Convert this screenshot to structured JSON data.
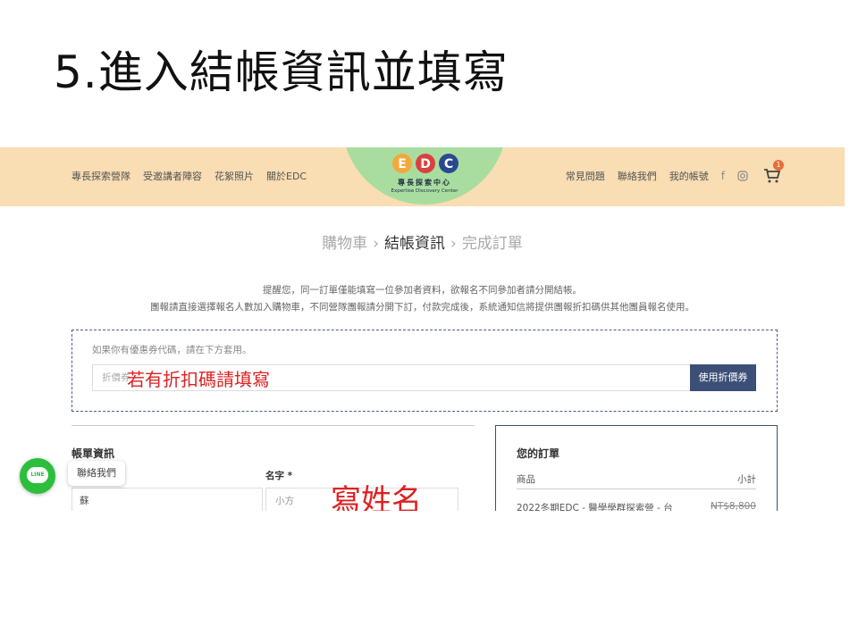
{
  "slide": {
    "title": "5.進入結帳資訊並填寫"
  },
  "header": {
    "nav_left": [
      "專長探索營隊",
      "受邀講者陣容",
      "花絮照片",
      "關於EDC"
    ],
    "nav_right": [
      "常見問題",
      "聯絡我們",
      "我的帳號"
    ],
    "cart_count": "1",
    "logo": {
      "letters": [
        "E",
        "D",
        "C"
      ],
      "cn": "專長探索中心",
      "en": "Expertise Discovery Center"
    },
    "colors": {
      "bar": "#f9ddb3",
      "logo_bg": "#a9dda0"
    }
  },
  "steps": {
    "items": [
      "購物車",
      "結帳資訊",
      "完成訂單"
    ],
    "current_index": 1
  },
  "notice": {
    "line1": "提醒您，同一訂單僅能填寫一位參加者資料，欲報名不同參加者請分開結帳。",
    "line2": "團報請直接選擇報名人數加入購物車，不同營隊團報請分開下訂，付款完成後，系統通知信將提供團報折扣碼供其他團員報名使用。"
  },
  "coupon": {
    "hint": "如果你有優惠券代碼，請在下方套用。",
    "placeholder": "折價券",
    "button": "使用折價券",
    "annotation": "若有折扣碼請填寫"
  },
  "billing": {
    "title": "帳單資訊",
    "first_name_label": "名字 *",
    "last_name_value": "蘇",
    "first_name_value": "小方",
    "annotation": "寫姓名"
  },
  "order": {
    "title": "您的訂單",
    "col_product": "商品",
    "col_subtotal": "小計",
    "item_name": "2022冬期EDC - 醫學學群探索營 - 台",
    "item_price": "NT$8,800"
  },
  "floating": {
    "line_label": "LINE",
    "contact": "聯絡我們"
  },
  "accent": {
    "annotation_red": "#dd2222",
    "button_navy": "#3b4f77"
  }
}
